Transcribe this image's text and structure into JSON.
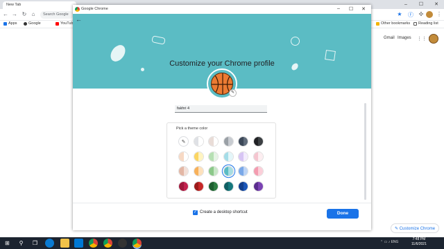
{
  "browser": {
    "tab_title": "New Tab",
    "omnibox_text": "Search Google",
    "bookmarks": [
      "Apps",
      "Google",
      "YouTube"
    ],
    "other_bookmarks": "Other bookmarks",
    "reading_list": "Reading list",
    "gmail": "Gmail",
    "images": "Images",
    "customize_chip": "Customize Chrome"
  },
  "dialog": {
    "title": "Google Chrome",
    "heading": "Customize your Chrome profile",
    "profile_name": "fakhri 4",
    "theme_label": "Pick a theme color",
    "shortcut_label": "Create a desktop shortcut",
    "shortcut_checked": true,
    "done_label": "Done",
    "banner_color": "#5bbcc4",
    "accent": "#1a73e8",
    "swatches": [
      [
        [
          "#ffffff",
          "#ffffff"
        ],
        [
          "#dfe1e5",
          "#ffffff"
        ],
        [
          "#e9dcd7",
          "#ffffff"
        ],
        [
          "#9aa0a6",
          "#c8ccd1"
        ],
        [
          "#3c4858",
          "#5f6b7a"
        ],
        [
          "#202124",
          "#3c4043"
        ]
      ],
      [
        [
          "#f7d9c4",
          "#ffffff"
        ],
        [
          "#fbd562",
          "#fff4c1"
        ],
        [
          "#b7e0b4",
          "#e6f4e5"
        ],
        [
          "#a5dde8",
          "#e4f6f9"
        ],
        [
          "#d7c5f4",
          "#f3ecfd"
        ],
        [
          "#f5c6d0",
          "#fdeef1"
        ]
      ],
      [
        [
          "#e3b7a5",
          "#f3e0d8"
        ],
        [
          "#f8b15a",
          "#fde1bd"
        ],
        [
          "#8cc88a",
          "#c9e7c8"
        ],
        [
          "#5bbcc4",
          "#a7dde1"
        ],
        [
          "#7aa8e8",
          "#bdd4f5"
        ],
        [
          "#f49cb0",
          "#fbcfd9"
        ]
      ],
      [
        [
          "#a0173b",
          "#c2224e"
        ],
        [
          "#9c1a1a",
          "#c62828"
        ],
        [
          "#1d5e2f",
          "#2e7d42"
        ],
        [
          "#0f5f63",
          "#16787d"
        ],
        [
          "#123e8c",
          "#1b56b8"
        ],
        [
          "#5b2d8e",
          "#7b43b3"
        ]
      ]
    ],
    "selected_swatch": "2-3"
  },
  "taskbar": {
    "time": "7:48 PM",
    "date": "11/6/2021",
    "lang": "ENG"
  }
}
